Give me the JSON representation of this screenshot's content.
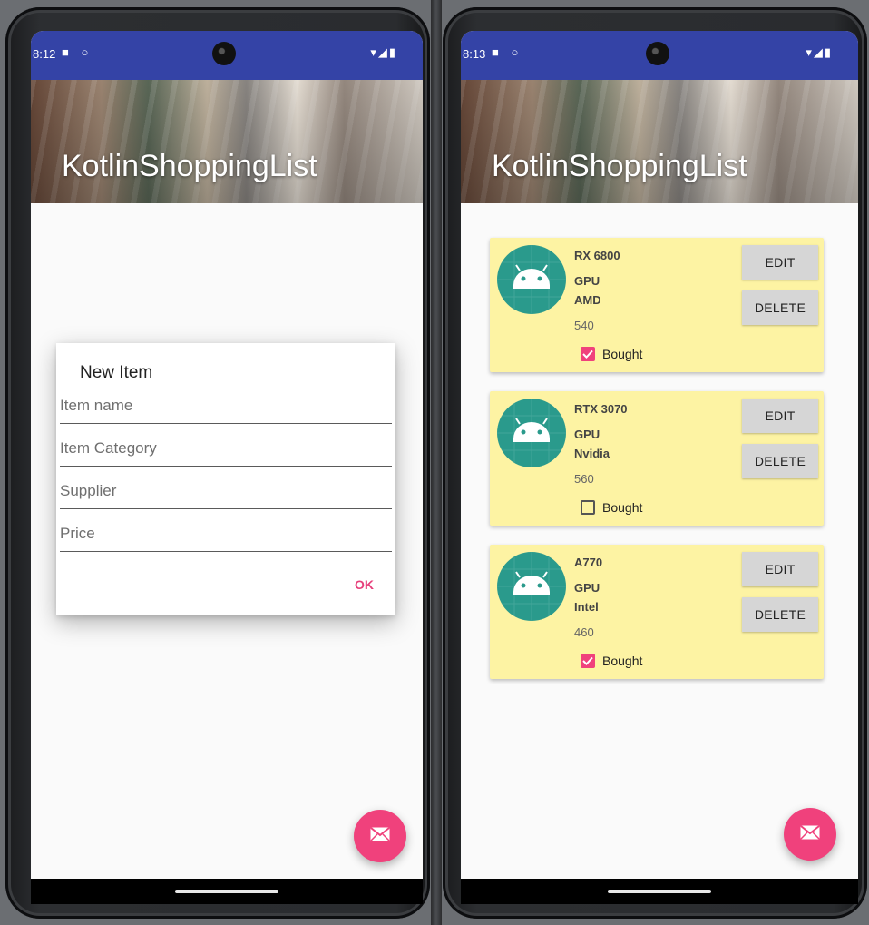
{
  "colors": {
    "status_bar": "#3443a6",
    "accent": "#f0417c",
    "card_bg": "#fdf3a3",
    "button_bg": "#d6d6d6"
  },
  "left_phone": {
    "status": {
      "time": "8:12",
      "left_icons": "■ ○",
      "right_icons": "▾◢▮"
    },
    "app_title": "KotlinShoppingList",
    "dialog": {
      "title": "New Item",
      "fields": [
        {
          "placeholder": "Item name"
        },
        {
          "placeholder": "Item Category"
        },
        {
          "placeholder": "Supplier"
        },
        {
          "placeholder": "Price"
        }
      ],
      "ok_label": "OK"
    },
    "fab_icon": "mail-icon"
  },
  "right_phone": {
    "status": {
      "time": "8:13",
      "left_icons": "■ ○",
      "right_icons": "▾◢▮"
    },
    "app_title": "KotlinShoppingList",
    "items": [
      {
        "name": "RX 6800",
        "category": "GPU",
        "supplier": "AMD",
        "price": "540",
        "bought_label": "Bought",
        "bought": true,
        "edit_label": "EDIT",
        "delete_label": "DELETE"
      },
      {
        "name": "RTX 3070",
        "category": "GPU",
        "supplier": "Nvidia",
        "price": "560",
        "bought_label": "Bought",
        "bought": false,
        "edit_label": "EDIT",
        "delete_label": "DELETE"
      },
      {
        "name": "A770",
        "category": "GPU",
        "supplier": "Intel",
        "price": "460",
        "bought_label": "Bought",
        "bought": true,
        "edit_label": "EDIT",
        "delete_label": "DELETE"
      }
    ],
    "fab_icon": "mail-icon"
  }
}
